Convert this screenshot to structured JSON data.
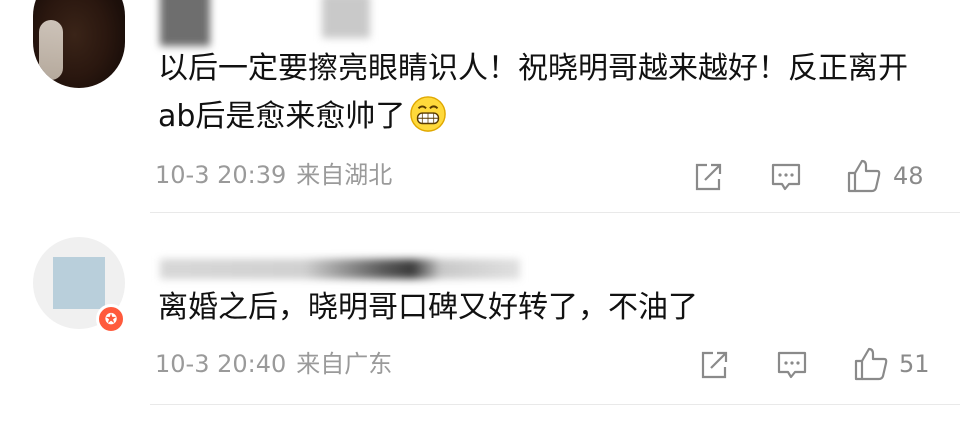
{
  "comments": [
    {
      "text": "以后一定要擦亮眼睛识人！祝晓明哥越来越好！反正离开ab后是愈来愈帅了",
      "emoji_icon": "grinning-face-icon",
      "date": "10-3 20:39",
      "location": "来自湖北",
      "like_count": "48"
    },
    {
      "text": "离婚之后，晓明哥口碑又好转了，不油了",
      "date": "10-3 20:40",
      "location": "来自广东",
      "like_count": "51",
      "badge": "✪"
    }
  ],
  "icons": {
    "share": "share-icon",
    "reply": "comment-icon",
    "like": "thumbs-up-icon"
  },
  "colors": {
    "text": "#111111",
    "meta": "#9a9a9a",
    "icon": "#8a8a8a",
    "divider": "#e9e9e9",
    "badge": "#ff5a3c"
  }
}
